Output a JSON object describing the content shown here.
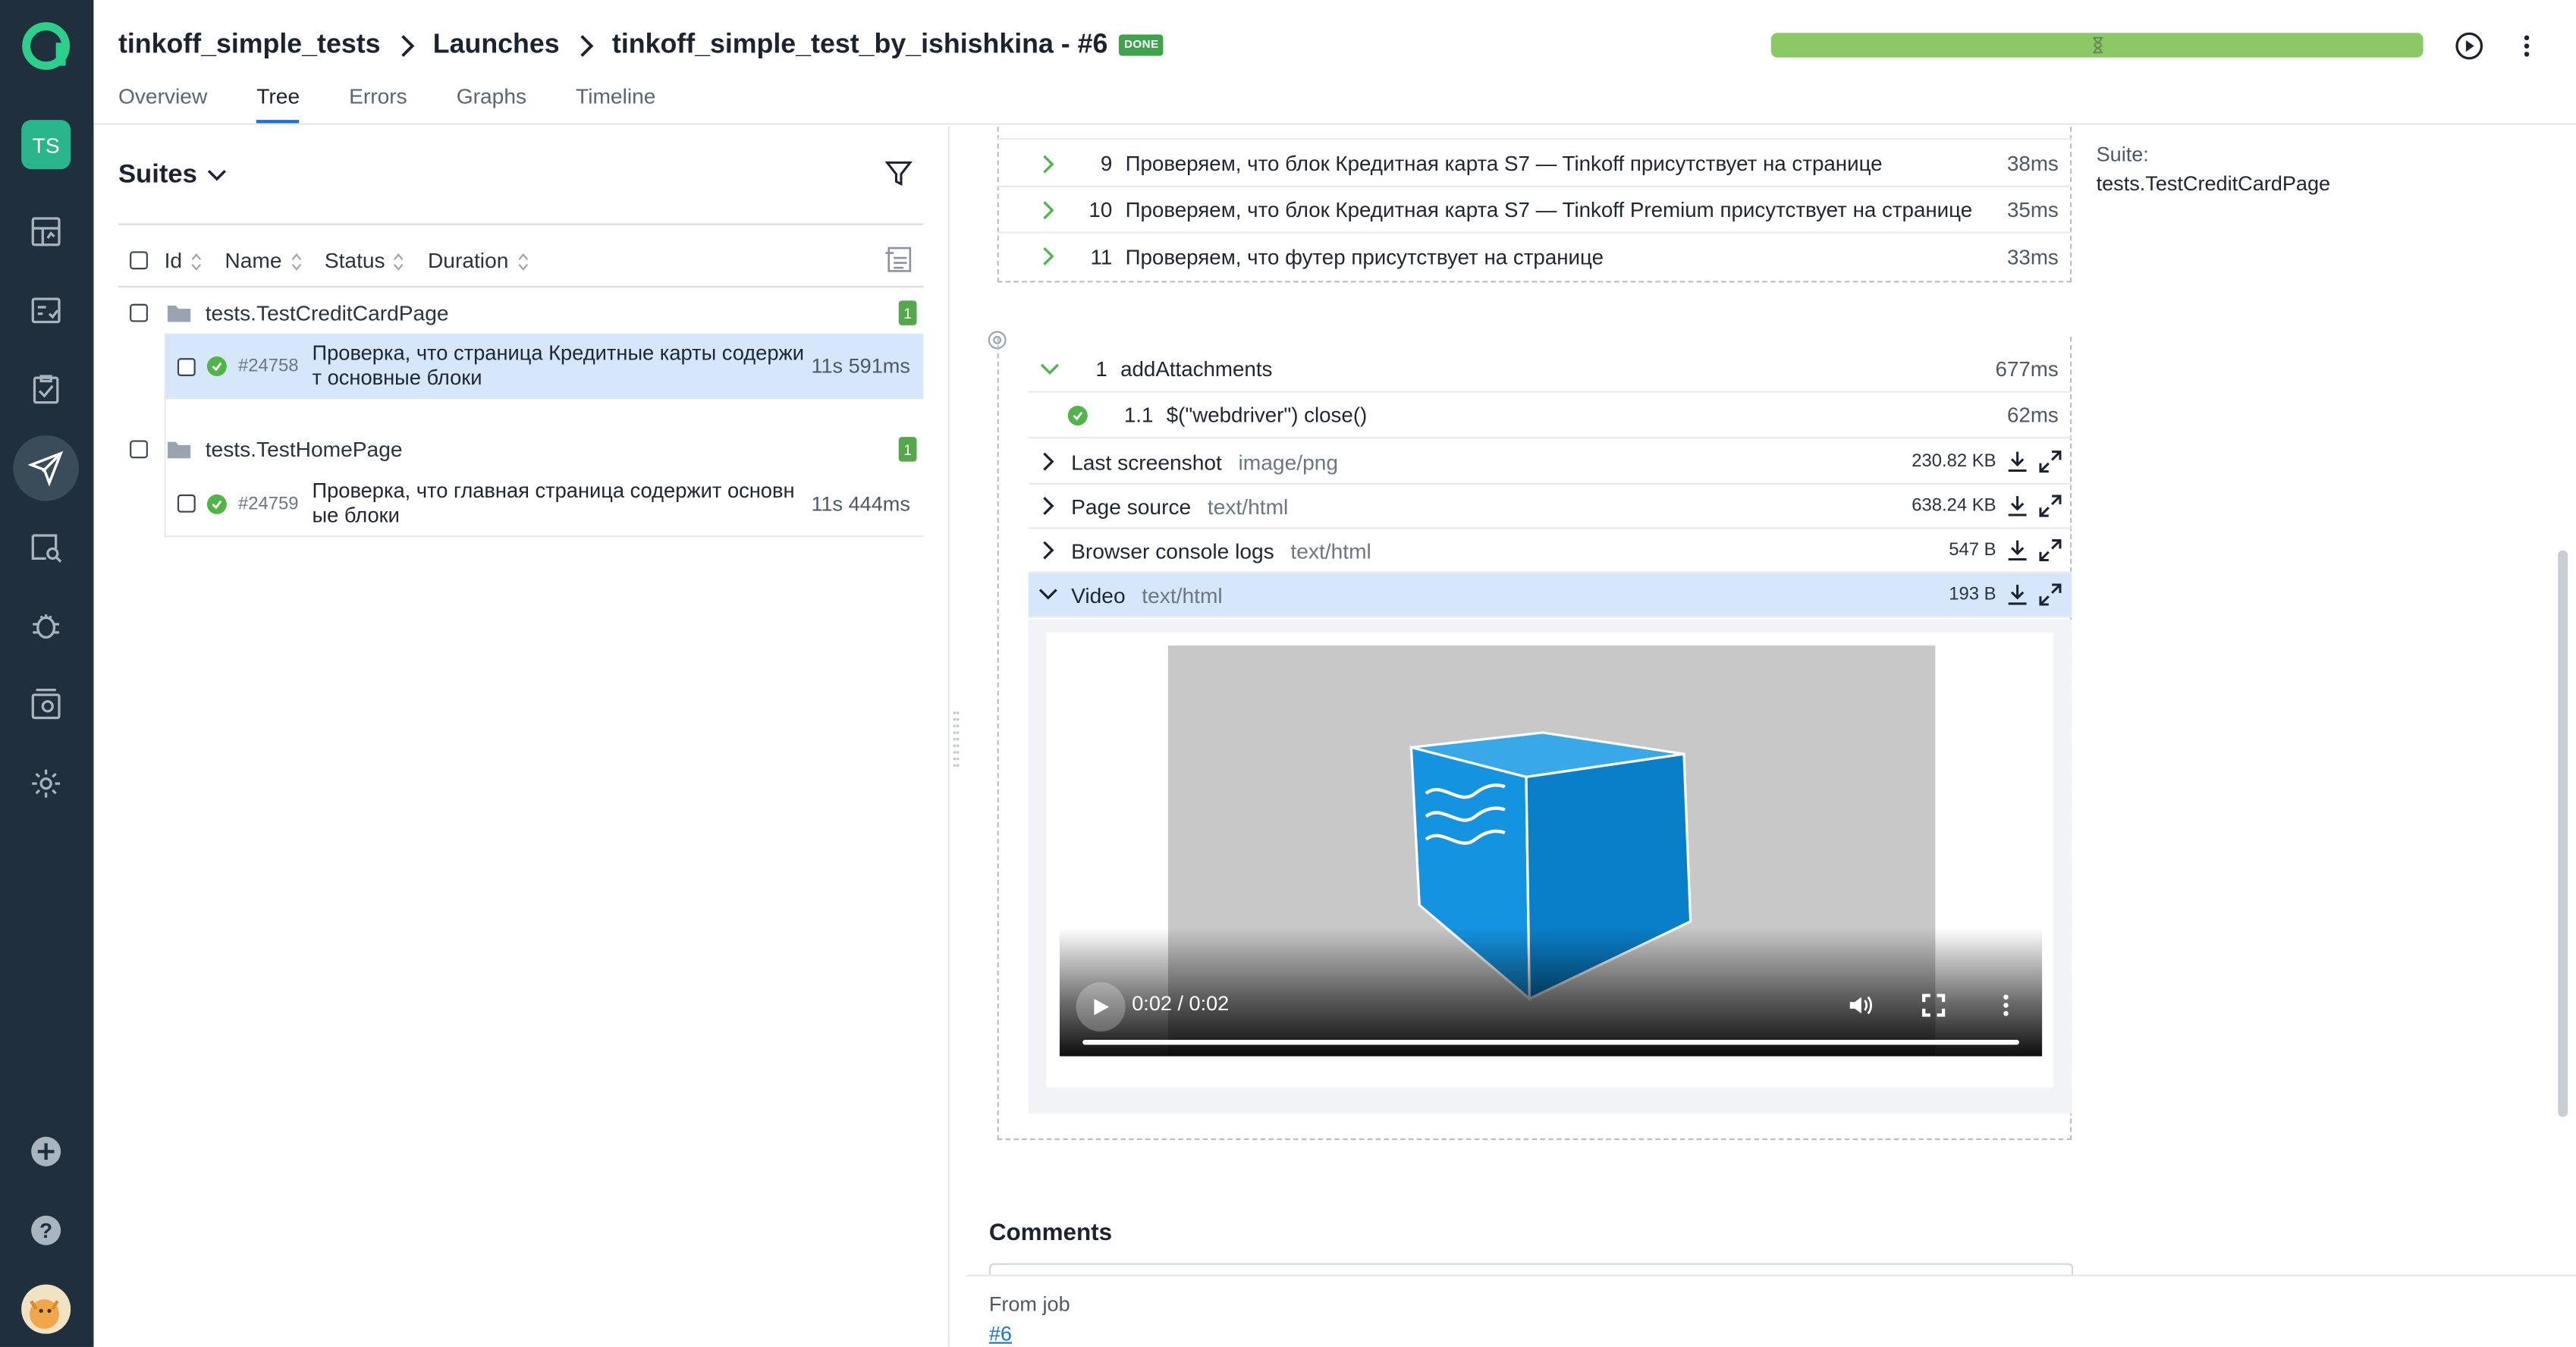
{
  "header": {
    "breadcrumb": {
      "project": "tinkoff_simple_tests",
      "section": "Launches",
      "launch": "tinkoff_simple_test_by_ishishkina - #6",
      "status_badge": "DONE"
    },
    "progress_fraction": 1.0,
    "tabs": [
      {
        "label": "Overview",
        "active": false
      },
      {
        "label": "Tree",
        "active": true
      },
      {
        "label": "Errors",
        "active": false
      },
      {
        "label": "Graphs",
        "active": false
      },
      {
        "label": "Timeline",
        "active": false
      }
    ]
  },
  "rail": {
    "project_initials": "TS",
    "items": [
      "dashboard-icon",
      "test-cases-icon",
      "test-plans-icon",
      "launches-icon",
      "analytics-icon",
      "defects-icon",
      "jobs-icon",
      "settings-icon"
    ],
    "bottom": [
      "add-icon",
      "help-icon",
      "avatar"
    ]
  },
  "left": {
    "title": "Suites",
    "columns": [
      "Id",
      "Name",
      "Status",
      "Duration"
    ],
    "suites": [
      {
        "name": "tests.TestCreditCardPage",
        "count": "1",
        "tests": [
          {
            "id": "#24758",
            "name": "Проверка, что страница Кредитные карты содержит основные блоки",
            "name_lines": [
              "Проверка, что страница Кредитные карты содержи",
              "т основные блоки"
            ],
            "duration": "11s 591ms",
            "selected": true
          }
        ]
      },
      {
        "name": "tests.TestHomePage",
        "count": "1",
        "tests": [
          {
            "id": "#24759",
            "name": "Проверка, что главная страница содержит основные блоки",
            "name_lines": [
              "Проверка, что главная страница содержит основн",
              "ые блоки"
            ],
            "duration": "11s 444ms",
            "selected": false
          }
        ]
      }
    ]
  },
  "steps": [
    {
      "num": "9",
      "name": "Проверяем, что блок Кредитная карта S7 — Tinkoff присутствует на странице",
      "duration": "38ms"
    },
    {
      "num": "10",
      "name": "Проверяем, что блок Кредитная карта S7 — Tinkoff Premium присутствует на странице",
      "duration": "35ms"
    },
    {
      "num": "11",
      "name": "Проверяем, что футер присутствует на странице",
      "duration": "33ms"
    }
  ],
  "fixture": {
    "num": "1",
    "name": "addAttachments",
    "duration": "677ms",
    "substep": {
      "num": "1.1",
      "name": "$(\"webdriver\") close()",
      "duration": "62ms"
    },
    "attachments": [
      {
        "name": "Last screenshot",
        "type": "image/png",
        "size": "230.82 KB",
        "expanded": false
      },
      {
        "name": "Page source",
        "type": "text/html",
        "size": "638.24 KB",
        "expanded": false
      },
      {
        "name": "Browser console logs",
        "type": "text/html",
        "size": "547 B",
        "expanded": false
      },
      {
        "name": "Video",
        "type": "text/html",
        "size": "193 B",
        "expanded": true
      }
    ]
  },
  "video": {
    "time": "0:02 / 0:02",
    "played_fraction": 1.0
  },
  "meta": {
    "suite_label": "Suite:",
    "suite_value": "tests.TestCreditCardPage"
  },
  "comments": {
    "title": "Comments"
  },
  "footer": {
    "from_job_label": "From job",
    "job_link": "#6"
  },
  "colors": {
    "rail": "#1f2f3d",
    "accent": "#1e6fd9",
    "passed": "#4fb548",
    "progress": "#8bc966",
    "selected_row": "#d7e7fb"
  }
}
